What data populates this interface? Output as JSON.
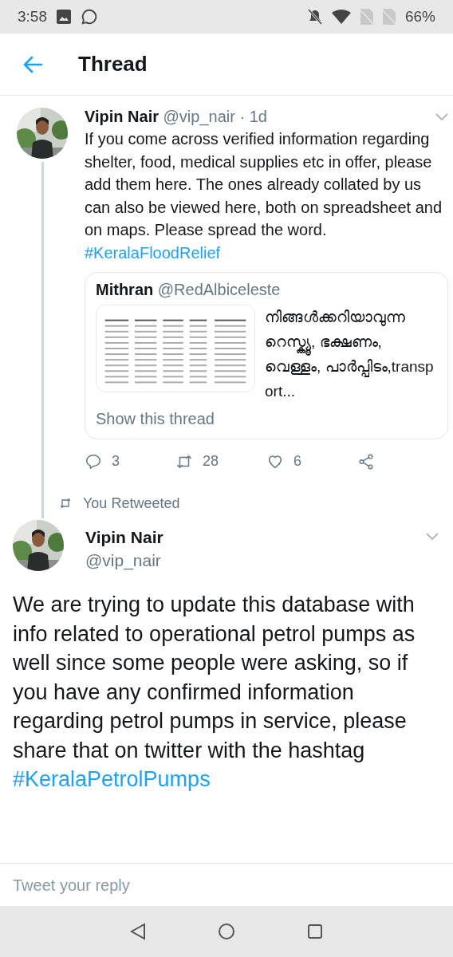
{
  "status_bar": {
    "time": "3:58",
    "battery": "66%"
  },
  "header": {
    "title": "Thread"
  },
  "tweets": [
    {
      "kind": "quote",
      "name": "Vipin Nair",
      "handle": "@vip_nair",
      "time": "· 1d",
      "text": "If you come across verified information regarding shelter, food, medical supplies etc in offer, please add them here. The ones already collated by us can also be viewed here, both on spreadsheet and on maps. Please spread the word. ",
      "hashtag": "#KeralaFloodRelief",
      "quoted": {
        "name": "Mithran",
        "handle": "@RedAlbiceleste",
        "text": "നിങ്ങൾക്കറിയാവുന്ന റെസ്ക്യൂ, ഭക്ഷണം,വെള്ളം, പാർപ്പിടം,transport...",
        "link": "Show this thread"
      },
      "actions": [
        {
          "kind": "reply",
          "count": "3"
        },
        {
          "kind": "retweet",
          "count": "28"
        },
        {
          "kind": "like",
          "count": "6"
        },
        {
          "kind": "share"
        }
      ]
    },
    {
      "kind": "big",
      "context": "You Retweeted",
      "name": "Vipin Nair",
      "handle": "@vip_nair",
      "text": "We are trying to update this database with info related to operational petrol pumps as well since some people were asking, so if you have any confirmed information regarding petrol pumps in service, please share that on twitter with the hashtag ",
      "hashtag": "#KeralaPetrolPumps"
    }
  ],
  "reply": {
    "placeholder": "Tweet your reply"
  }
}
